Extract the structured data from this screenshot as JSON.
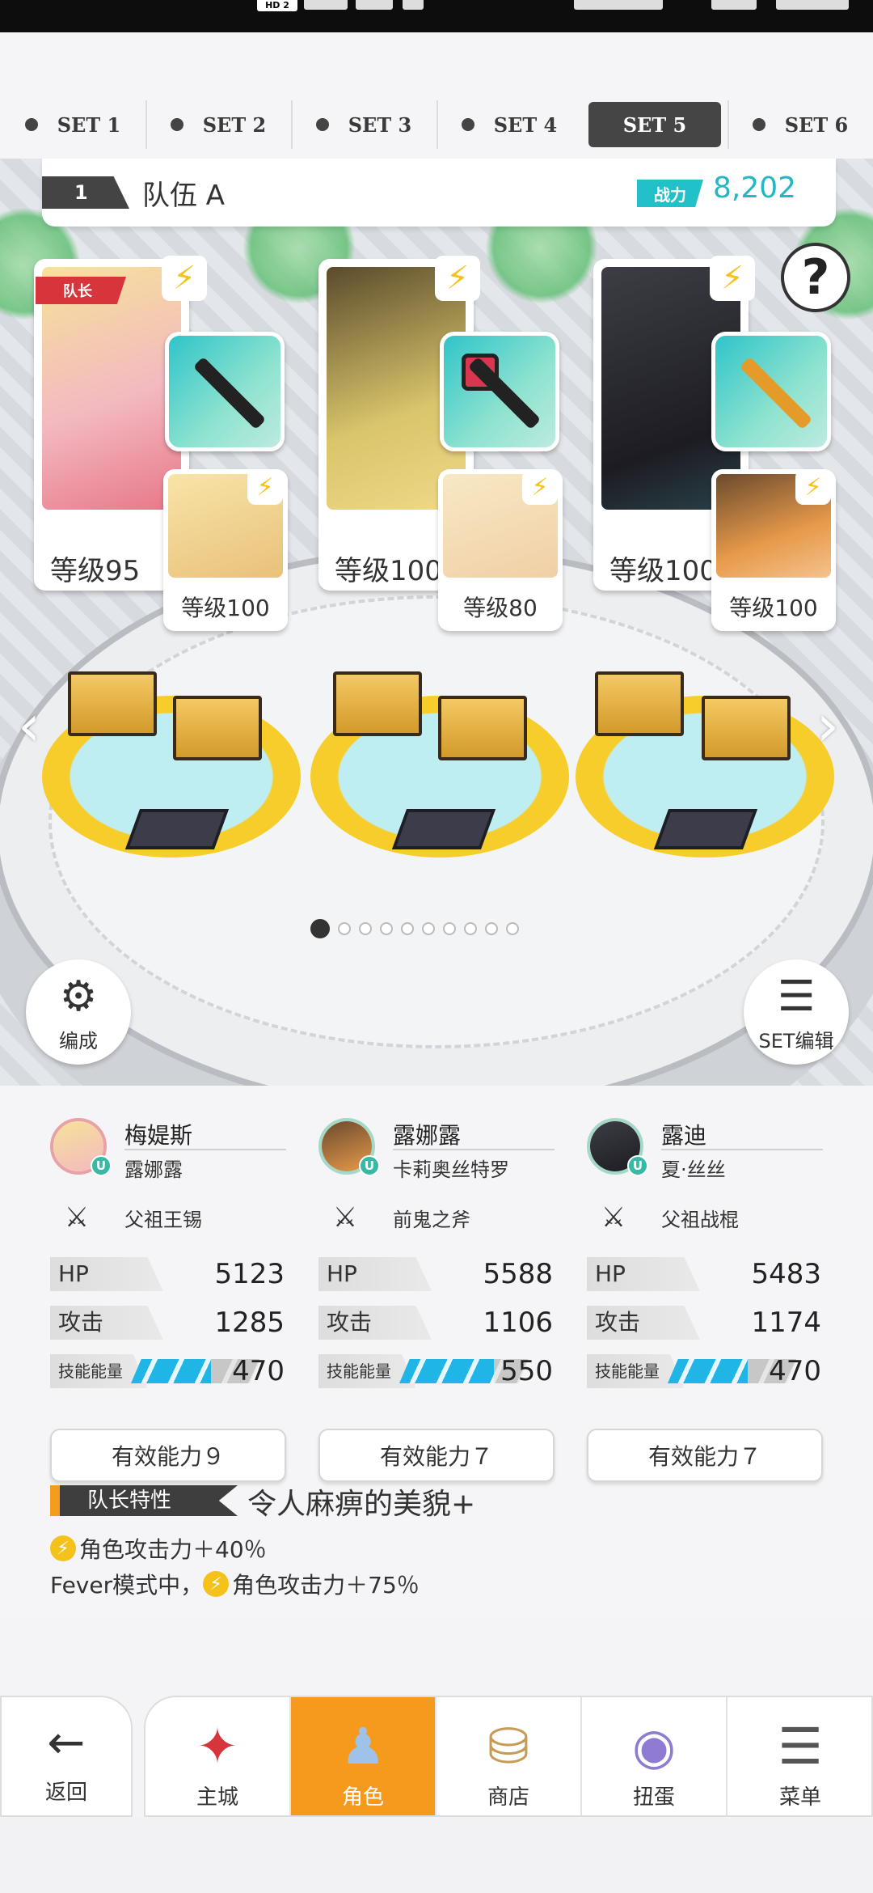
{
  "status_bar": {
    "hd_label": "HD 2"
  },
  "set_tabs": [
    {
      "label": "SET 1",
      "active": false
    },
    {
      "label": "SET 2",
      "active": false
    },
    {
      "label": "SET 3",
      "active": false
    },
    {
      "label": "SET 4",
      "active": false
    },
    {
      "label": "SET 5",
      "active": true
    },
    {
      "label": "SET 6",
      "active": false
    }
  ],
  "team": {
    "number": "1",
    "name": "队伍 A",
    "power_label": "战力",
    "power_value": "8,202"
  },
  "help_icon": "?",
  "leader_tag": "队长",
  "characters": [
    {
      "main_level": "等级95",
      "sub_level": "等级100"
    },
    {
      "main_level": "等级100",
      "sub_level": "等级80"
    },
    {
      "main_level": "等级100",
      "sub_level": "等级100"
    }
  ],
  "pager": {
    "total": 10,
    "current": 1
  },
  "buttons": {
    "formation": "编成",
    "set_edit": "SET编辑"
  },
  "stats": [
    {
      "name": "梅媞斯",
      "sub_name": "露娜露",
      "weapon": "父祖王锡",
      "hp_label": "HP",
      "hp": "5123",
      "atk_label": "攻击",
      "atk": "1285",
      "energy_label": "技能能量",
      "energy": "470",
      "energy_fill": 0.62,
      "ability": "有效能力９"
    },
    {
      "name": "露娜露",
      "sub_name": "卡莉奥丝特罗",
      "weapon": "前鬼之斧",
      "hp_label": "HP",
      "hp": "5588",
      "atk_label": "攻击",
      "atk": "1106",
      "energy_label": "技能能量",
      "energy": "550",
      "energy_fill": 0.73,
      "ability": "有效能力７"
    },
    {
      "name": "露迪",
      "sub_name": "夏·丝丝",
      "weapon": "父祖战棍",
      "hp_label": "HP",
      "hp": "5483",
      "atk_label": "攻击",
      "atk": "1174",
      "energy_label": "技能能量",
      "energy": "470",
      "energy_fill": 0.62,
      "ability": "有效能力７"
    }
  ],
  "leader_trait": {
    "tag": "队长特性",
    "name": "令人麻痹的美貌+",
    "line1": "角色攻击力＋40％",
    "line2_prefix": "Fever模式中，",
    "line2": "角色攻击力＋75％"
  },
  "bottom_nav": {
    "back": "返回",
    "items": [
      {
        "label": "主城",
        "active": false
      },
      {
        "label": "角色",
        "active": true
      },
      {
        "label": "商店",
        "active": false
      },
      {
        "label": "扭蛋",
        "active": false
      },
      {
        "label": "菜单",
        "active": false
      }
    ]
  },
  "colors": {
    "accent_orange": "#f59a1d",
    "power_teal": "#22c0c8",
    "energy_blue": "#1fb6e6",
    "leader_red": "#d8343b",
    "dark_tab": "#454545"
  }
}
